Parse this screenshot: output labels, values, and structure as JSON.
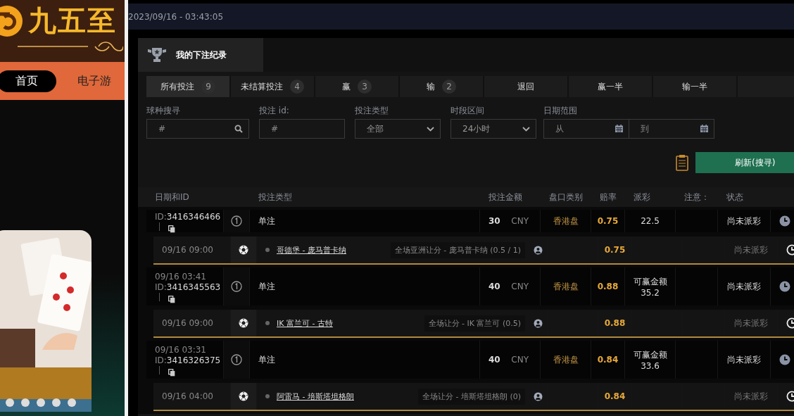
{
  "site": {
    "logo_text": "九五至",
    "nav": [
      {
        "label": "首页",
        "selected": true
      },
      {
        "label": "电子游",
        "selected": false
      }
    ]
  },
  "timestamp": "2023/09/16 - 03:43:05",
  "panel": {
    "title": "我的下注纪录"
  },
  "tabs": [
    {
      "label": "所有投注",
      "count": "9",
      "selected": true
    },
    {
      "label": "未结算投注",
      "count": "4",
      "selected": false
    },
    {
      "label": "赢",
      "count": "3",
      "selected": false
    },
    {
      "label": "输",
      "count": "2",
      "selected": false
    },
    {
      "label": "退回",
      "selected": false
    },
    {
      "label": "赢一半",
      "selected": false
    },
    {
      "label": "输一半",
      "selected": false
    }
  ],
  "filters": [
    {
      "kind": "search",
      "label": "球种搜寻",
      "placeholder": "#"
    },
    {
      "kind": "text",
      "label": "投注 id:",
      "placeholder": "#"
    },
    {
      "kind": "select",
      "label": "投注类型",
      "value": "全部"
    },
    {
      "kind": "select",
      "label": "时段区间",
      "value": "24小时"
    },
    {
      "kind": "daterange",
      "label": "日期范围",
      "from_placeholder": "从",
      "to_placeholder": "到"
    }
  ],
  "refresh_button": "刷新(搜寻)",
  "table": {
    "columns": [
      "日期和ID",
      "投注类型",
      "投注金额",
      "盘口类别",
      "赔率",
      "派彩",
      "注意：",
      "状态"
    ],
    "rows": [
      {
        "kind": "bet",
        "id_prefix": "ID:",
        "id": "3416346466",
        "type": "单注",
        "amount": "30",
        "currency": "CNY",
        "market": "香港盘",
        "odds": "0.75",
        "payout": "22.5",
        "status": "尚未派彩"
      },
      {
        "kind": "match",
        "date": "09/16 09:00",
        "match": "哥德堡 - 庞马普卡纳",
        "selection": "全场亚洲让分 - 庞马普卡纳 (0.5 / 1)",
        "odds": "0.75",
        "status": "尚未派彩"
      },
      {
        "kind": "bet",
        "date": "09/16 03:41",
        "id_prefix": "ID:",
        "id": "3416345563",
        "type": "单注",
        "amount": "40",
        "currency": "CNY",
        "market": "香港盘",
        "odds": "0.88",
        "payout_label": "可赢金额",
        "payout": "35.2",
        "status": "尚未派彩"
      },
      {
        "kind": "match",
        "date": "09/16 09:00",
        "match": "IK 富兰可 - 古特",
        "selection": "全场让分 - IK 富兰可 (0.5)",
        "odds": "0.88",
        "status": "尚未派彩"
      },
      {
        "kind": "bet",
        "date": "09/16 03:31",
        "id_prefix": "ID:",
        "id": "3416326375",
        "type": "单注",
        "amount": "40",
        "currency": "CNY",
        "market": "香港盘",
        "odds": "0.84",
        "payout_label": "可赢金额",
        "payout": "33.6",
        "status": "尚未派彩"
      },
      {
        "kind": "match",
        "date": "09/16 04:00",
        "match": "阿雷马 - 培斯塔坦格朗",
        "selection": "全场让分 - 培斯塔坦格朗 (0)",
        "odds": "0.84",
        "status": "尚未派彩"
      }
    ]
  }
}
